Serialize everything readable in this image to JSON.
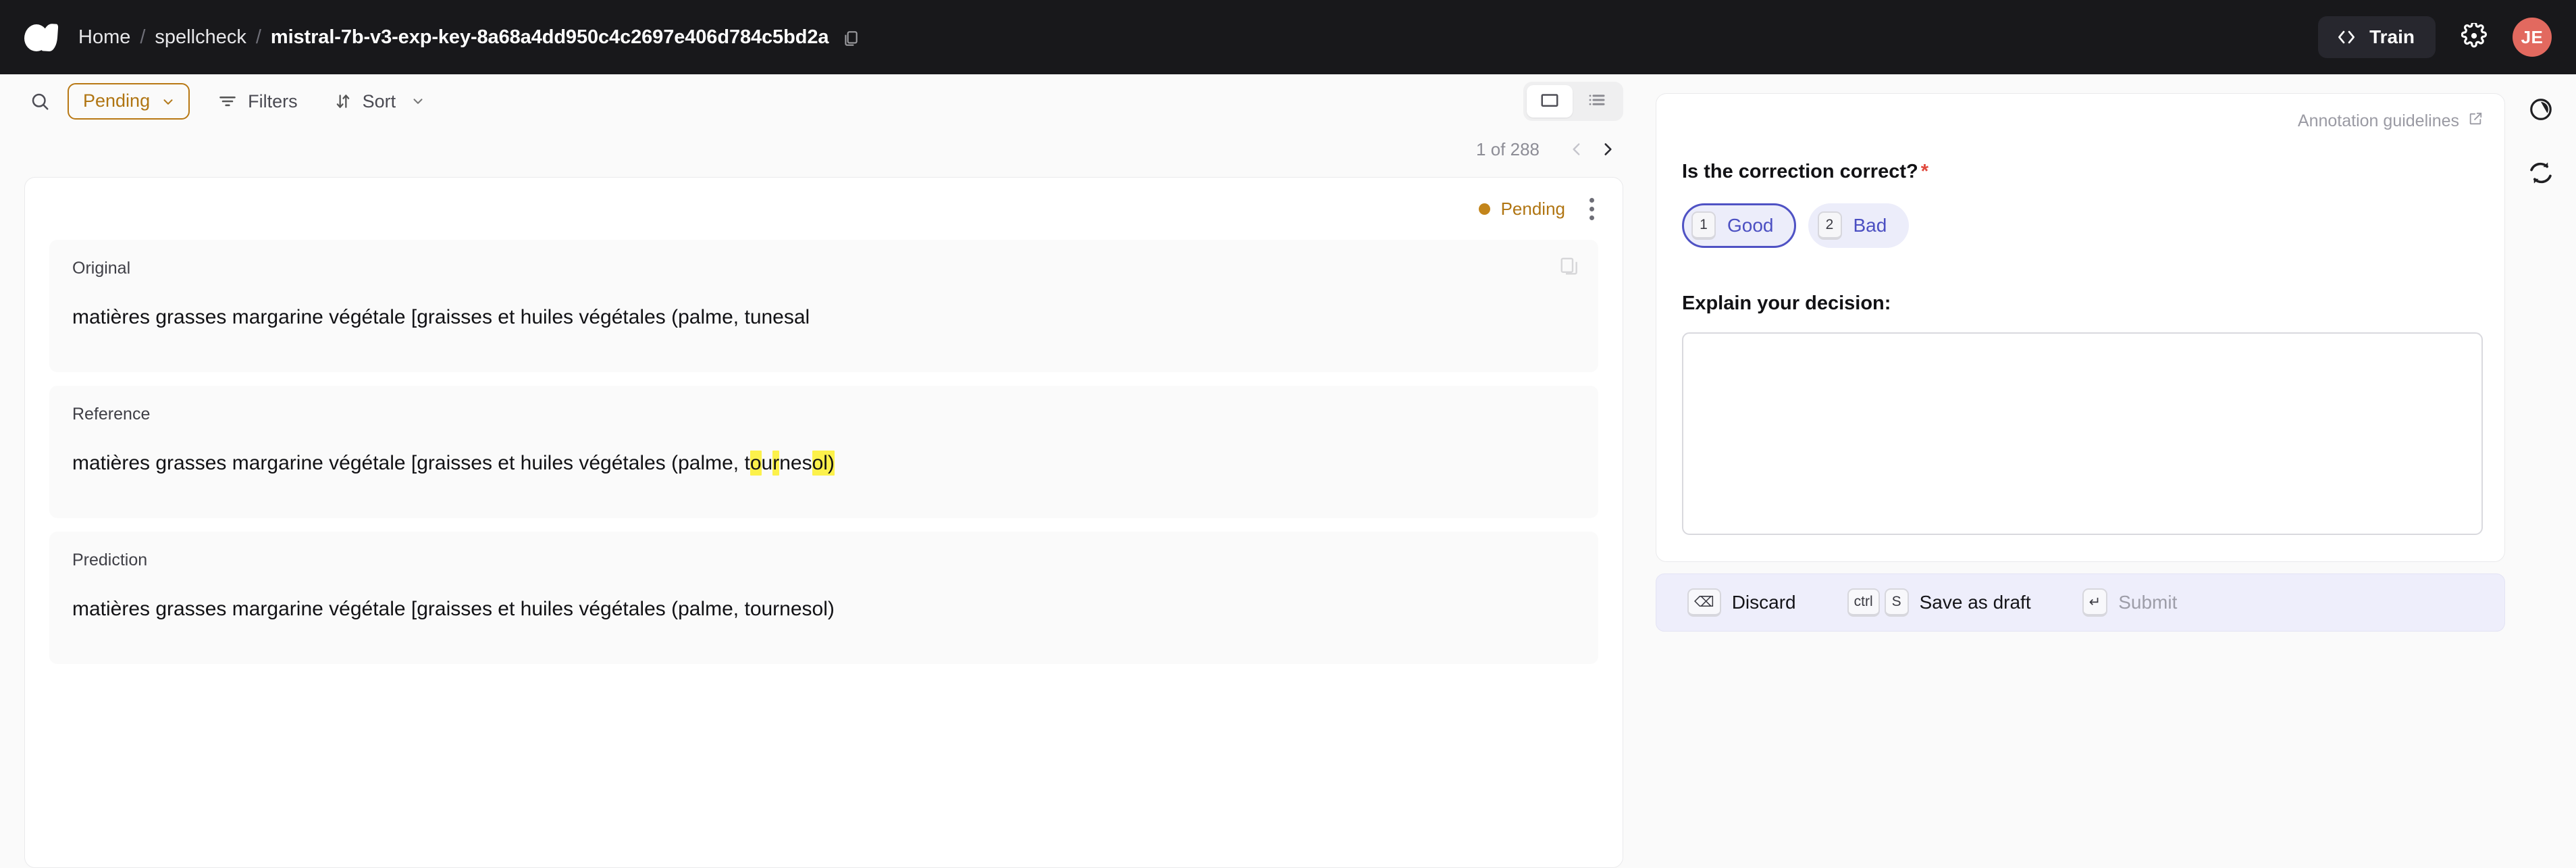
{
  "topbar": {
    "logo_name": "argilla-logo",
    "breadcrumb": {
      "home": "Home",
      "workspace": "spellcheck",
      "dataset": "mistral-7b-v3-exp-key-8a68a4dd950c4c2697e406d784c5bd2a",
      "separator": "/",
      "copy_icon": "copy-icon"
    },
    "train_button": {
      "label": "Train",
      "icon": "code-brackets-icon"
    },
    "settings_icon": "gear-icon",
    "avatar_initials": "JE",
    "avatar_color": "#e2695f",
    "background_color": "#18181b"
  },
  "toolbar": {
    "search_icon": "search-icon",
    "status_filter": {
      "value": "Pending",
      "icon": "chevron-down-icon",
      "accent_color": "#b07512"
    },
    "filters_button": {
      "label": "Filters",
      "icon": "filter-icon"
    },
    "sort_button": {
      "label": "Sort",
      "icon": "sort-arrows-icon",
      "chevron": "chevron-down-icon"
    },
    "view_toggle": {
      "options": [
        {
          "name": "focus-view",
          "icon": "rectangle-icon",
          "selected": true
        },
        {
          "name": "bulk-view",
          "icon": "list-icon",
          "selected": false
        }
      ]
    }
  },
  "pagination": {
    "label": "1 of 288",
    "current": 1,
    "total": 288,
    "prev_icon": "chevron-left-icon",
    "prev_enabled": false,
    "next_icon": "chevron-right-icon",
    "next_enabled": true
  },
  "record": {
    "status": {
      "label": "Pending",
      "color": "#b07512",
      "dot_color": "#c3851b"
    },
    "menu_icon": "kebab-menu-icon",
    "copy_icon": "copy-icon",
    "fields": [
      {
        "label": "Original",
        "segments": [
          {
            "text": "matières grasses margarine végétale [graisses et huiles végétales (palme, tunesal",
            "highlight": false
          }
        ],
        "has_copy": true
      },
      {
        "label": "Reference",
        "segments": [
          {
            "text": "matières grasses margarine végétale [graisses et huiles végétales (palme, t",
            "highlight": false
          },
          {
            "text": "o",
            "highlight": true
          },
          {
            "text": "u",
            "highlight": false
          },
          {
            "text": "r",
            "highlight": true
          },
          {
            "text": "nes",
            "highlight": false
          },
          {
            "text": "ol)",
            "highlight": true
          }
        ],
        "has_copy": false
      },
      {
        "label": "Prediction",
        "segments": [
          {
            "text": "matières grasses margarine végétale [graisses et huiles végétales (palme, tournesol)",
            "highlight": false
          }
        ],
        "has_copy": false
      }
    ]
  },
  "annotation": {
    "guidelines": {
      "label": "Annotation guidelines",
      "icon": "external-link-icon"
    },
    "question": {
      "title": "Is the correction correct?",
      "required_marker": "*",
      "options": [
        {
          "shortcut": "1",
          "label": "Good",
          "selected": true
        },
        {
          "shortcut": "2",
          "label": "Bad",
          "selected": false
        }
      ]
    },
    "explain": {
      "label": "Explain your decision:",
      "value": "",
      "placeholder": ""
    },
    "actions": [
      {
        "name": "discard",
        "label": "Discard",
        "keys": [
          "⌫"
        ],
        "disabled": false
      },
      {
        "name": "save-as-draft",
        "label": "Save as draft",
        "keys": [
          "ctrl",
          "S"
        ],
        "disabled": false
      },
      {
        "name": "submit",
        "label": "Submit",
        "keys": [
          "↵"
        ],
        "disabled": true
      }
    ]
  },
  "right_rail": {
    "items": [
      {
        "name": "progress-icon",
        "label": "progress"
      },
      {
        "name": "refresh-icon",
        "label": "refresh"
      }
    ]
  }
}
